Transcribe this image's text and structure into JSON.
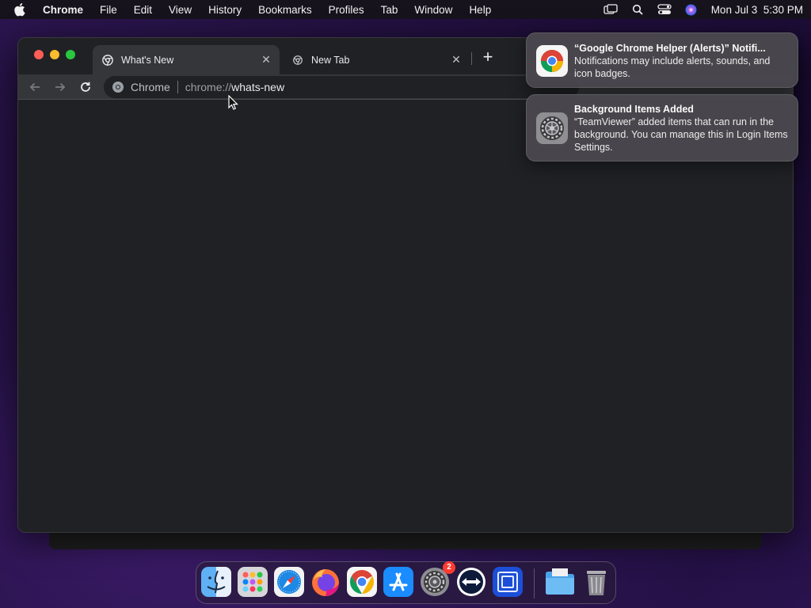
{
  "menubar": {
    "app_name": "Chrome",
    "menus": [
      "File",
      "Edit",
      "View",
      "History",
      "Bookmarks",
      "Profiles",
      "Tab",
      "Window",
      "Help"
    ],
    "clock": "Mon Jul 3  5:30 PM",
    "status_icons": [
      "screen-mirror-icon",
      "spotlight-icon",
      "control-center-icon",
      "siri-icon"
    ]
  },
  "browser": {
    "tabs": [
      {
        "title": "What's New",
        "active": true
      },
      {
        "title": "New Tab",
        "active": false
      }
    ],
    "omnibox": {
      "chip": "Chrome",
      "scheme": "chrome://",
      "host": "whats-new"
    }
  },
  "notifications": [
    {
      "title": "“Google Chrome Helper (Alerts)” Notifi...",
      "body": "Notifications may include alerts, sounds, and icon badges.",
      "icon": "chrome-icon"
    },
    {
      "title": "Background Items Added",
      "body": "“TeamViewer” added items that can run in the background. You can manage this in Login Items Settings.",
      "icon": "system-settings-icon"
    }
  ],
  "dock": {
    "items": [
      "Finder",
      "Launchpad",
      "Safari",
      "Firefox",
      "Google Chrome",
      "App Store",
      "System Settings",
      "TeamViewer",
      "Screen Sharing",
      "Downloads",
      "Trash"
    ],
    "settings_badge": "2"
  },
  "colors": {
    "window_bg": "#202124",
    "toolbar_bg": "#35363a",
    "menubar_bg": "#17131d"
  }
}
